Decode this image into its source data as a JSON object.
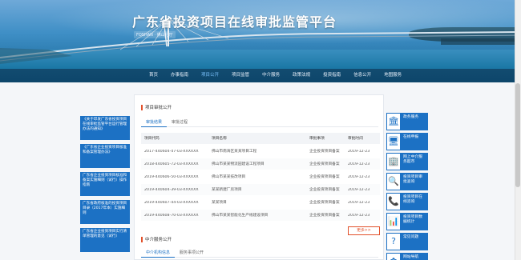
{
  "header": {
    "title": "广东省投资项目在线审批监管平台",
    "subtitle": "FOSHAN · 佛山分厅"
  },
  "nav": {
    "items": [
      "首页",
      "办事指南",
      "项目公开",
      "项目监管",
      "中介服务",
      "政策法规",
      "投资指南",
      "信息公开",
      "地图服务"
    ],
    "active_index": 2
  },
  "left_sidebar": {
    "items": [
      "《关于印发广东省投资项目在线审批监管平台运行管理办法的通知》",
      "《广东省企业投资项目核准和备案管理办法》",
      "广东省企业投资项目核准和备案实施细则（试行）操作指南",
      "广东省政府核准的投资项目目录（2017年本）实施细则",
      "广东省企业投资项目实行清单管理的意见（试行）"
    ]
  },
  "main": {
    "section1_title": "项目审批公开",
    "tabs1": [
      "审批结果",
      "审批过程"
    ],
    "table": {
      "headers": [
        "项目代码",
        "项目名称",
        "审批事项",
        "审批时间"
      ],
      "rows": [
        [
          "2017-440604-47-03-XXXXXX",
          "佛山市南海区某某项目工程",
          "企业投资项目备案",
          "2019-12-23"
        ],
        [
          "2018-440605-72-03-XXXXXX",
          "佛山市某某物流园建设工程项目",
          "企业投资项目备案",
          "2019-12-23"
        ],
        [
          "2019-440606-50-03-XXXXXX",
          "佛山市某某技改项目",
          "企业投资项目备案",
          "2019-12-23"
        ],
        [
          "2019-440604-39-03-XXXXXX",
          "某某新建厂房项目",
          "企业投资项目备案",
          "2019-12-23"
        ],
        [
          "2019-440607-44-03-XXXXXX",
          "某某项目",
          "企业投资项目备案",
          "2019-12-23"
        ],
        [
          "2019-440608-70-03-XXXXXX",
          "佛山市某某智能化生产线建设项目",
          "企业投资项目备案",
          "2019-12-23"
        ]
      ]
    },
    "more_label": "更多>>",
    "section2_title": "中介服务公开",
    "tabs2": [
      "中介机构信息",
      "服务事项公开"
    ]
  },
  "right_sidebar": {
    "items": [
      {
        "icon": "bank-icon",
        "glyph": "🏛",
        "label": "政务服务"
      },
      {
        "icon": "monitor-icon",
        "glyph": "🖥",
        "label": "在线申报"
      },
      {
        "icon": "building-icon",
        "glyph": "🏢",
        "label": "网上中介服务超市"
      },
      {
        "icon": "search-icon",
        "glyph": "🔍",
        "label": "投资项目审批查询"
      },
      {
        "icon": "phone-icon",
        "glyph": "📞",
        "label": "投资项目在线咨询"
      },
      {
        "icon": "screen-icon",
        "glyph": "📊",
        "label": "投资项目数据统计"
      },
      {
        "icon": "question-icon",
        "glyph": "?",
        "label": "常见问题"
      },
      {
        "icon": "flower-icon",
        "glyph": "✿",
        "label": "网站导航"
      }
    ]
  }
}
